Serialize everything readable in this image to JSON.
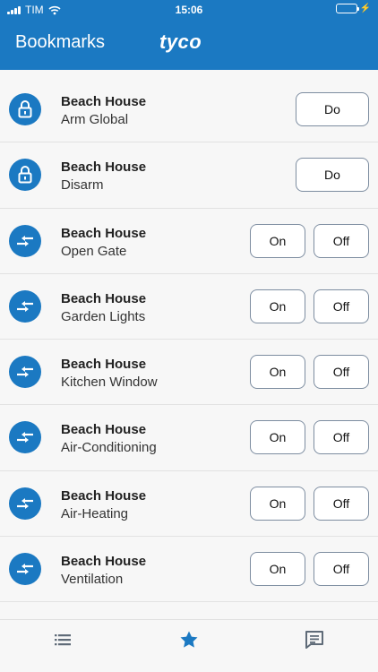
{
  "status_bar": {
    "carrier": "TIM",
    "time": "15:06"
  },
  "header": {
    "title": "Bookmarks",
    "brand": "tyco"
  },
  "bookmarks": [
    {
      "title": "Beach House",
      "action": "Arm Global",
      "icon": "lock-icon",
      "kind": "do"
    },
    {
      "title": "Beach House",
      "action": "Disarm",
      "icon": "lock-icon",
      "kind": "do"
    },
    {
      "title": "Beach House",
      "action": "Open Gate",
      "icon": "switch-arrows-icon",
      "kind": "onoff"
    },
    {
      "title": "Beach House",
      "action": "Garden Lights",
      "icon": "switch-arrows-icon",
      "kind": "onoff"
    },
    {
      "title": "Beach House",
      "action": "Kitchen Window",
      "icon": "switch-arrows-icon",
      "kind": "onoff"
    },
    {
      "title": "Beach House",
      "action": "Air-Conditioning",
      "icon": "switch-arrows-icon",
      "kind": "onoff"
    },
    {
      "title": "Beach House",
      "action": "Air-Heating",
      "icon": "switch-arrows-icon",
      "kind": "onoff"
    },
    {
      "title": "Beach House",
      "action": "Ventilation",
      "icon": "switch-arrows-icon",
      "kind": "onoff"
    }
  ],
  "labels": {
    "do": "Do",
    "on": "On",
    "off": "Off"
  },
  "tabs": [
    {
      "name": "list-icon"
    },
    {
      "name": "star-icon",
      "active": true
    },
    {
      "name": "message-icon"
    }
  ],
  "colors": {
    "accent": "#1b79c2",
    "battery": "#4cd964",
    "active_tab": "#1b79c2",
    "inactive_tab": "#5f6b78"
  }
}
